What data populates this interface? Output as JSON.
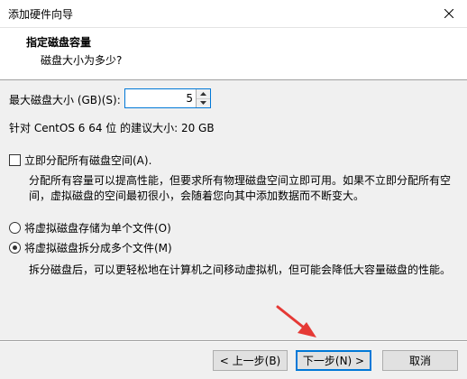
{
  "window": {
    "title": "添加硬件向导"
  },
  "header": {
    "title": "指定磁盘容量",
    "subtitle": "磁盘大小为多少?"
  },
  "disk_size": {
    "label": "最大磁盘大小 (GB)(S):",
    "value": "5"
  },
  "recommendation": "针对 CentOS 6 64 位 的建议大小: 20 GB",
  "allocate_now": {
    "label": "立即分配所有磁盘空间(A).",
    "checked": false,
    "description_line1": "分配所有容量可以提高性能，但要求所有物理磁盘空间立即可用。如果不立即分配所有空",
    "description_line2": "间，虚拟磁盘的空间最初很小，会随着您向其中添加数据而不断变大。"
  },
  "storage_options": [
    {
      "label": "将虚拟磁盘存储为单个文件(O)",
      "selected": false
    },
    {
      "label": "将虚拟磁盘拆分成多个文件(M)",
      "selected": true
    }
  ],
  "split_description": "拆分磁盘后，可以更轻松地在计算机之间移动虚拟机，但可能会降低大容量磁盘的性能。",
  "buttons": {
    "back": "< 上一步(B)",
    "next": "下一步(N) >",
    "cancel": "取消"
  },
  "colors": {
    "accent": "#0078d7",
    "annotation_arrow": "#e53935"
  },
  "icons": {
    "close": "close-icon",
    "spin_up": "chevron-up-icon",
    "spin_down": "chevron-down-icon",
    "annotation": "red-arrow-annotation"
  }
}
